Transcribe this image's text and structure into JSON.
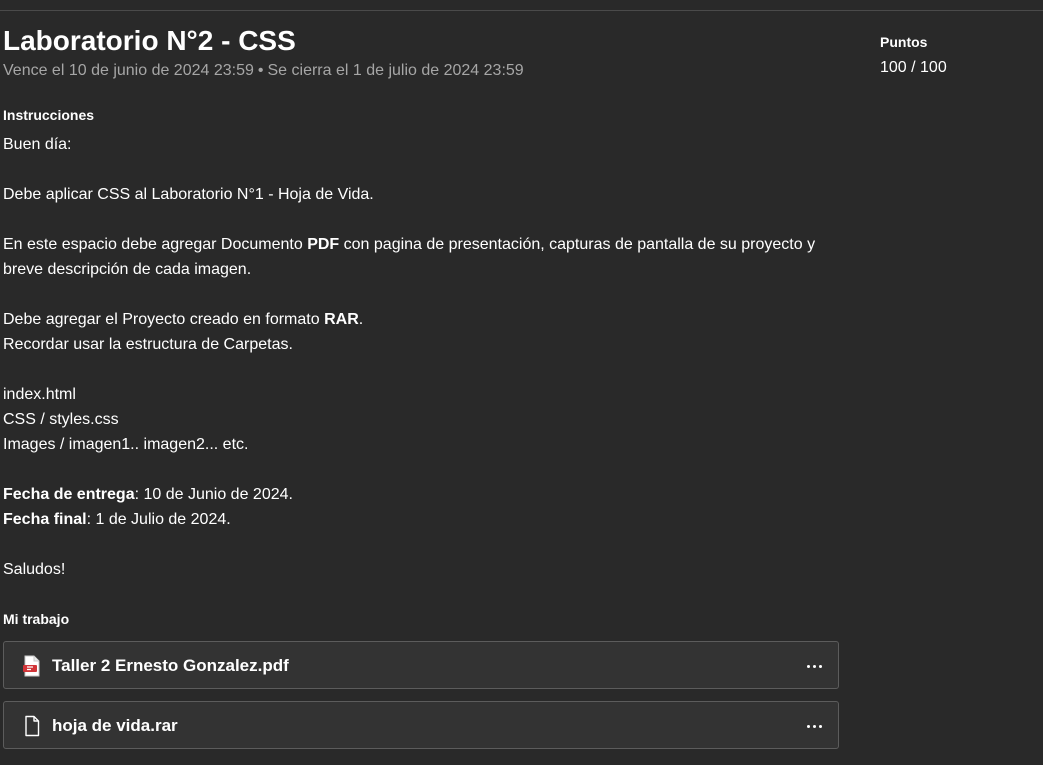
{
  "assignment": {
    "title": "Laboratorio N°2 - CSS",
    "due": "Vence el 10 de junio de 2024 23:59",
    "separator": "•",
    "closes": "Se cierra el 1 de julio de 2024 23:59"
  },
  "points": {
    "label": "Puntos",
    "value": "100 / 100"
  },
  "instructions": {
    "label": "Instrucciones",
    "greeting": "Buen día:",
    "line1": "Debe aplicar CSS al Laboratorio N°1 - Hoja de Vida.",
    "line2_a": "En este espacio debe agregar Documento ",
    "line2_b": "PDF",
    "line2_c": " con pagina de presentación, capturas de pantalla de su proyecto y breve descripción de cada imagen.",
    "line3_a": "Debe agregar el Proyecto creado en formato ",
    "line3_b": "RAR",
    "line3_c": ".",
    "line4": "Recordar usar la estructura de Carpetas.",
    "folder1": "index.html",
    "folder2": "CSS / styles.css",
    "folder3": "Images / imagen1.. imagen2... etc.",
    "delivery_label": "Fecha de entrega",
    "delivery_value": ": 10 de Junio de 2024.",
    "final_label": "Fecha final",
    "final_value": ": 1 de Julio de 2024.",
    "closing": "Saludos!"
  },
  "my_work": {
    "label": "Mi trabajo",
    "files": [
      {
        "name": "Taller 2 Ernesto Gonzalez.pdf",
        "icon": "pdf-file-icon",
        "icon_color": "#d13438"
      },
      {
        "name": "hoja de vida.rar",
        "icon": "generic-file-icon",
        "icon_color": "#ffffff"
      }
    ]
  }
}
